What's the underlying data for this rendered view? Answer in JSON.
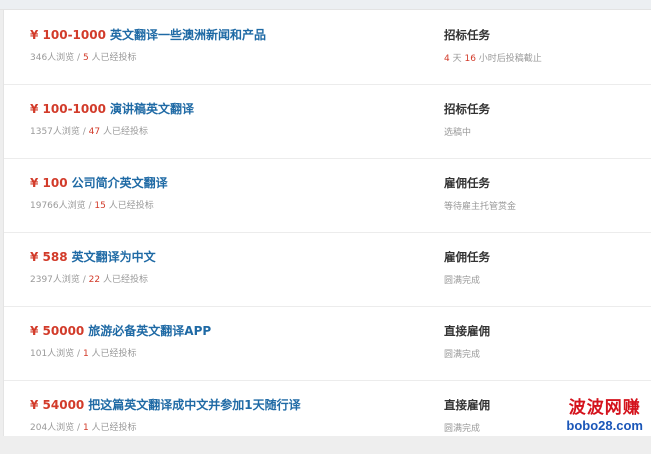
{
  "tasks": [
    {
      "price": "¥ 100-1000",
      "title": "英文翻译一些澳洲新闻和产品",
      "views": "346人浏览",
      "sep": " / ",
      "bids": "5",
      "bids_suffix": " 人已经投标",
      "type": "招标任务",
      "status_days": "4",
      "status_days_unit": " 天 ",
      "status_hours": "16",
      "status_text": " 小时后投稿截止"
    },
    {
      "price": "¥ 100-1000",
      "title": "演讲稿英文翻译",
      "views": "1357人浏览",
      "sep": " / ",
      "bids": "47",
      "bids_suffix": " 人已经投标",
      "type": "招标任务",
      "status_text": "选稿中"
    },
    {
      "price": "¥ 100",
      "title": "公司简介英文翻译",
      "views": "19766人浏览",
      "sep": " / ",
      "bids": "15",
      "bids_suffix": " 人已经投标",
      "type": "雇佣任务",
      "status_text": "等待雇主托管赏金"
    },
    {
      "price": "¥ 588",
      "title": "英文翻译为中文",
      "views": "2397人浏览",
      "sep": " / ",
      "bids": "22",
      "bids_suffix": " 人已经投标",
      "type": "雇佣任务",
      "status_text": "圆满完成"
    },
    {
      "price": "¥ 50000",
      "title": "旅游必备英文翻译APP",
      "views": "101人浏览",
      "sep": " / ",
      "bids": "1",
      "bids_suffix": " 人已经投标",
      "type": "直接雇佣",
      "status_text": "圆满完成"
    },
    {
      "price": "¥ 54000",
      "title": "把这篇英文翻译成中文并参加1天随行译",
      "views": "204人浏览",
      "sep": " / ",
      "bids": "1",
      "bids_suffix": " 人已经投标",
      "type": "直接雇佣",
      "status_text": "圆满完成"
    }
  ],
  "watermark": {
    "cn": "波波网赚",
    "url": "bobo28.com"
  },
  "colors": {
    "price": "#d23b2a",
    "title_link": "#1f6aa5",
    "meta": "#9a9a9a",
    "type": "#333333",
    "watermark_cn": "#d4121c",
    "watermark_url": "#1a56b8"
  }
}
